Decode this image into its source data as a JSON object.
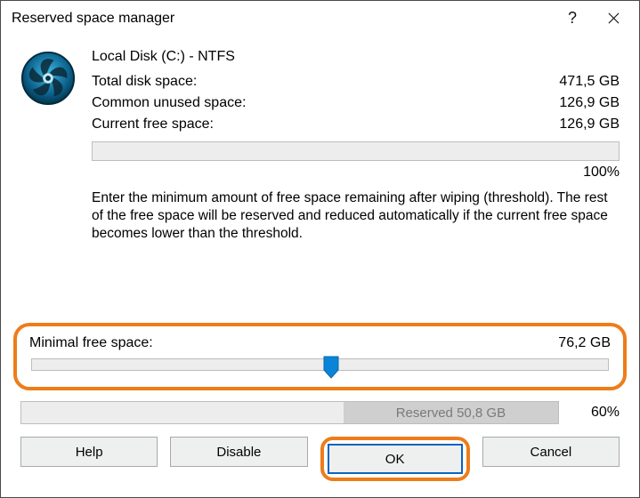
{
  "window": {
    "title": "Reserved space manager"
  },
  "disk": {
    "name": "Local Disk (C:) - NTFS",
    "total_label": "Total disk space:",
    "total_value": "471,5 GB",
    "common_unused_label": "Common unused space:",
    "common_unused_value": "126,9 GB",
    "current_free_label": "Current free space:",
    "current_free_value": "126,9 GB",
    "bar_percent": "100%"
  },
  "description": "Enter the minimum amount of free space remaining after wiping (threshold). The rest of the free space will be reserved and reduced automatically if the current free space becomes lower than the threshold.",
  "minimal": {
    "label": "Minimal free space:",
    "value": "76,2 GB",
    "slider_position_pct": 52
  },
  "reserved": {
    "label": "Reserved 50,8 GB",
    "fill_pct": 40,
    "percent": "60%"
  },
  "buttons": {
    "help": "Help",
    "disable": "Disable",
    "ok": "OK",
    "cancel": "Cancel"
  },
  "icons": {
    "help": "?",
    "close": "✕"
  }
}
